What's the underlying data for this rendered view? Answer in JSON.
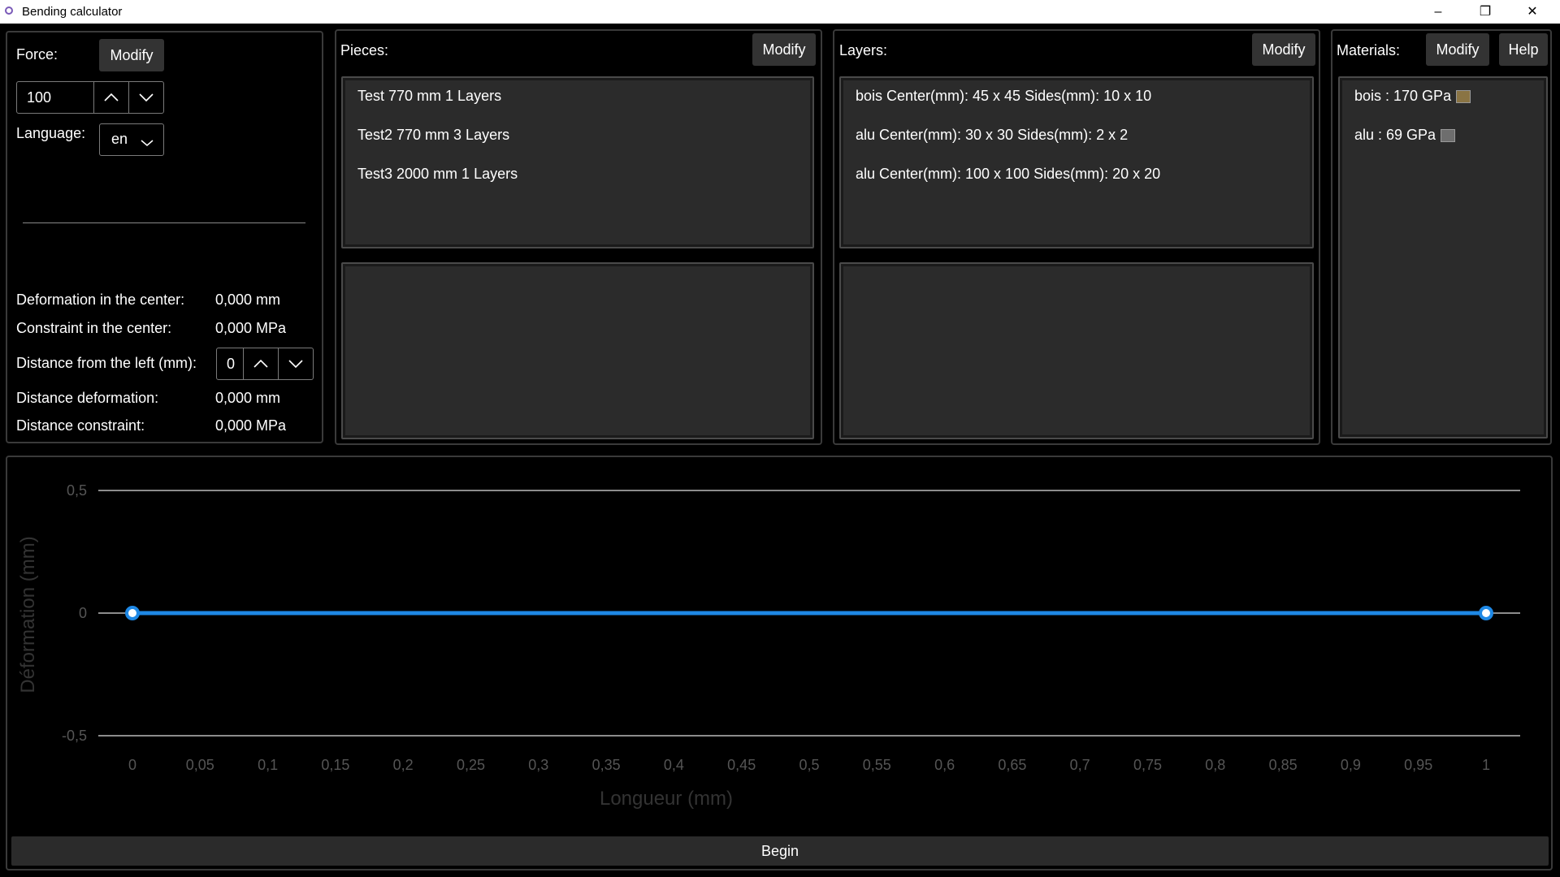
{
  "window": {
    "title": "Bending calculator",
    "minimize": "–",
    "maximize": "❐",
    "close": "✕"
  },
  "left_panel": {
    "force_label": "Force:",
    "force_modify": "Modify",
    "force_value": "100",
    "language_label": "Language:",
    "language_value": "en",
    "results": [
      {
        "label": "Deformation in the center:",
        "value": "0,000 mm"
      },
      {
        "label": "Constraint in the center:",
        "value": "0,000 MPa"
      }
    ],
    "distance_label": "Distance from the left (mm):",
    "distance_value": "0",
    "distance_results": [
      {
        "label": "Distance deformation:",
        "value": "0,000 mm"
      },
      {
        "label": "Distance constraint:",
        "value": "0,000 MPa"
      }
    ]
  },
  "pieces": {
    "label": "Pieces:",
    "modify": "Modify",
    "items": [
      "Test 770 mm 1 Layers",
      "Test2 770 mm 3 Layers",
      "Test3 2000 mm 1 Layers"
    ]
  },
  "layers": {
    "label": "Layers:",
    "modify": "Modify",
    "items": [
      "bois Center(mm): 45 x 45 Sides(mm): 10 x 10",
      "alu Center(mm): 30 x 30 Sides(mm): 2 x 2",
      "alu Center(mm): 100 x 100 Sides(mm): 20 x 20"
    ]
  },
  "materials": {
    "label": "Materials:",
    "modify": "Modify",
    "help": "Help",
    "items": [
      {
        "text": "bois : 170 GPa",
        "color": "#8a7444"
      },
      {
        "text": "alu : 69 GPa",
        "color": "#6e6e6e"
      }
    ]
  },
  "chart_data": {
    "type": "line",
    "xlabel": "Longueur (mm)",
    "ylabel": "Déformation (mm)",
    "xlim": [
      0,
      1
    ],
    "ylim": [
      -0.5,
      0.5
    ],
    "x_ticks": [
      "0",
      "0,05",
      "0,1",
      "0,15",
      "0,2",
      "0,25",
      "0,3",
      "0,35",
      "0,4",
      "0,45",
      "0,5",
      "0,55",
      "0,6",
      "0,65",
      "0,7",
      "0,75",
      "0,8",
      "0,85",
      "0,9",
      "0,95",
      "1"
    ],
    "y_ticks": [
      "0,5",
      "0",
      "-0,5"
    ],
    "series": [
      {
        "x": [
          0,
          1
        ],
        "y": [
          0,
          0
        ],
        "color": "#1e88e5"
      }
    ],
    "grid": true
  },
  "begin_button": "Begin"
}
